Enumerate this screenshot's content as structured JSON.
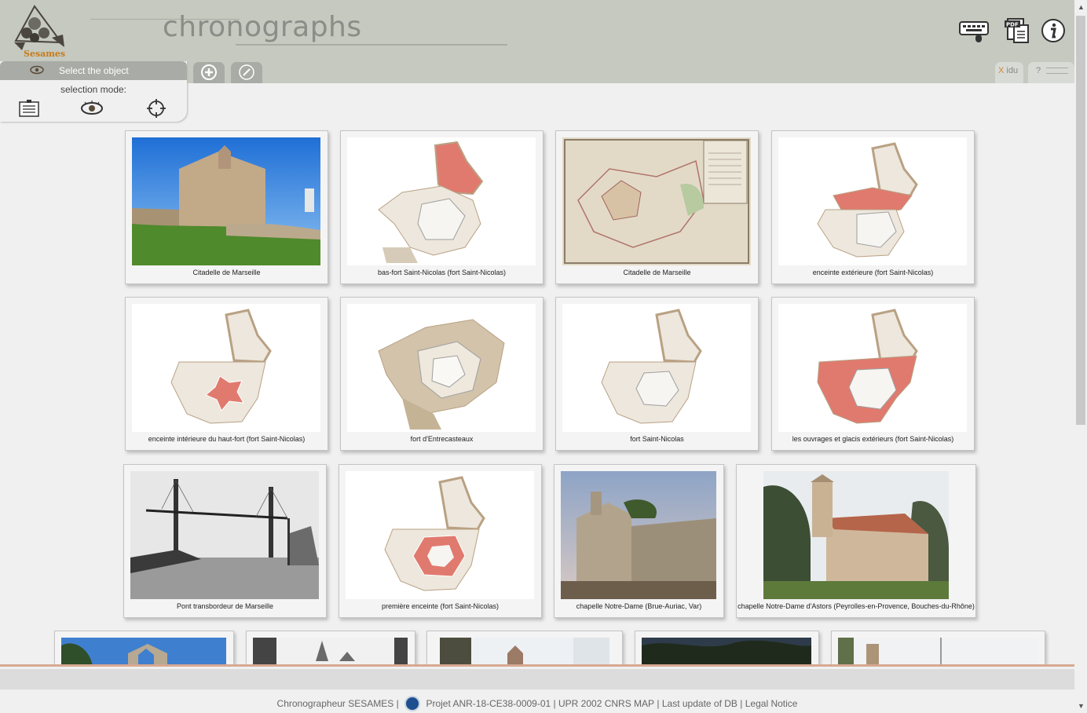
{
  "header": {
    "logo_text": "Sesames",
    "title": "chronographs",
    "icons": [
      "keyboard-icon",
      "pdf-icon",
      "info-icon"
    ]
  },
  "panel": {
    "tab_label": "Select the object",
    "selection_mode_label": "selection mode:",
    "modes": [
      "list-mode-icon",
      "eye-mode-icon",
      "target-mode-icon"
    ]
  },
  "tabs": {
    "add_label": "+",
    "edit_label": "✎",
    "right_tab_x": "X",
    "right_tab_user": "idu",
    "right_tab_help": "?"
  },
  "cards": [
    {
      "caption": "Citadelle de Marseille",
      "kind": "photo-fort"
    },
    {
      "caption": "bas-fort Saint-Nicolas (fort Saint-Nicolas)",
      "kind": "plan-top"
    },
    {
      "caption": "Citadelle de Marseille",
      "kind": "old-map"
    },
    {
      "caption": "enceinte extérieure (fort Saint-Nicolas)",
      "kind": "plan-mid"
    },
    {
      "caption": "enceinte intérieure du haut-fort (fort Saint-Nicolas)",
      "kind": "plan-star"
    },
    {
      "caption": "fort d'Entrecasteaux",
      "kind": "plan-tan"
    },
    {
      "caption": "fort Saint-Nicolas",
      "kind": "plan-plain"
    },
    {
      "caption": "les ouvrages et glacis extérieurs (fort Saint-Nicolas)",
      "kind": "plan-outer"
    },
    {
      "caption": "Pont transbordeur de Marseille",
      "kind": "photo-bw"
    },
    {
      "caption": "première enceinte (fort Saint-Nicolas)",
      "kind": "plan-first"
    },
    {
      "caption": "chapelle Notre-Dame (Brue-Auriac, Var)",
      "kind": "photo-chapel"
    },
    {
      "caption": "chapelle Notre-Dame d'Astors (Peyrolles-en-Provence, Bouches-du-Rhône)",
      "kind": "photo-chapel2"
    },
    {
      "caption": "",
      "kind": "photo-sky"
    },
    {
      "caption": "",
      "kind": "photo-trees"
    },
    {
      "caption": "",
      "kind": "photo-bell"
    },
    {
      "caption": "",
      "kind": "photo-dark"
    },
    {
      "caption": "",
      "kind": "photo-ruin"
    }
  ],
  "footer": {
    "app": "Chronographeur SESAMES",
    "project": "Projet ANR-18-CE38-0009-01",
    "upr": "UPR 2002 CNRS MAP",
    "last_update": "Last update of DB",
    "legal": "Legal Notice",
    "sep": "|"
  }
}
